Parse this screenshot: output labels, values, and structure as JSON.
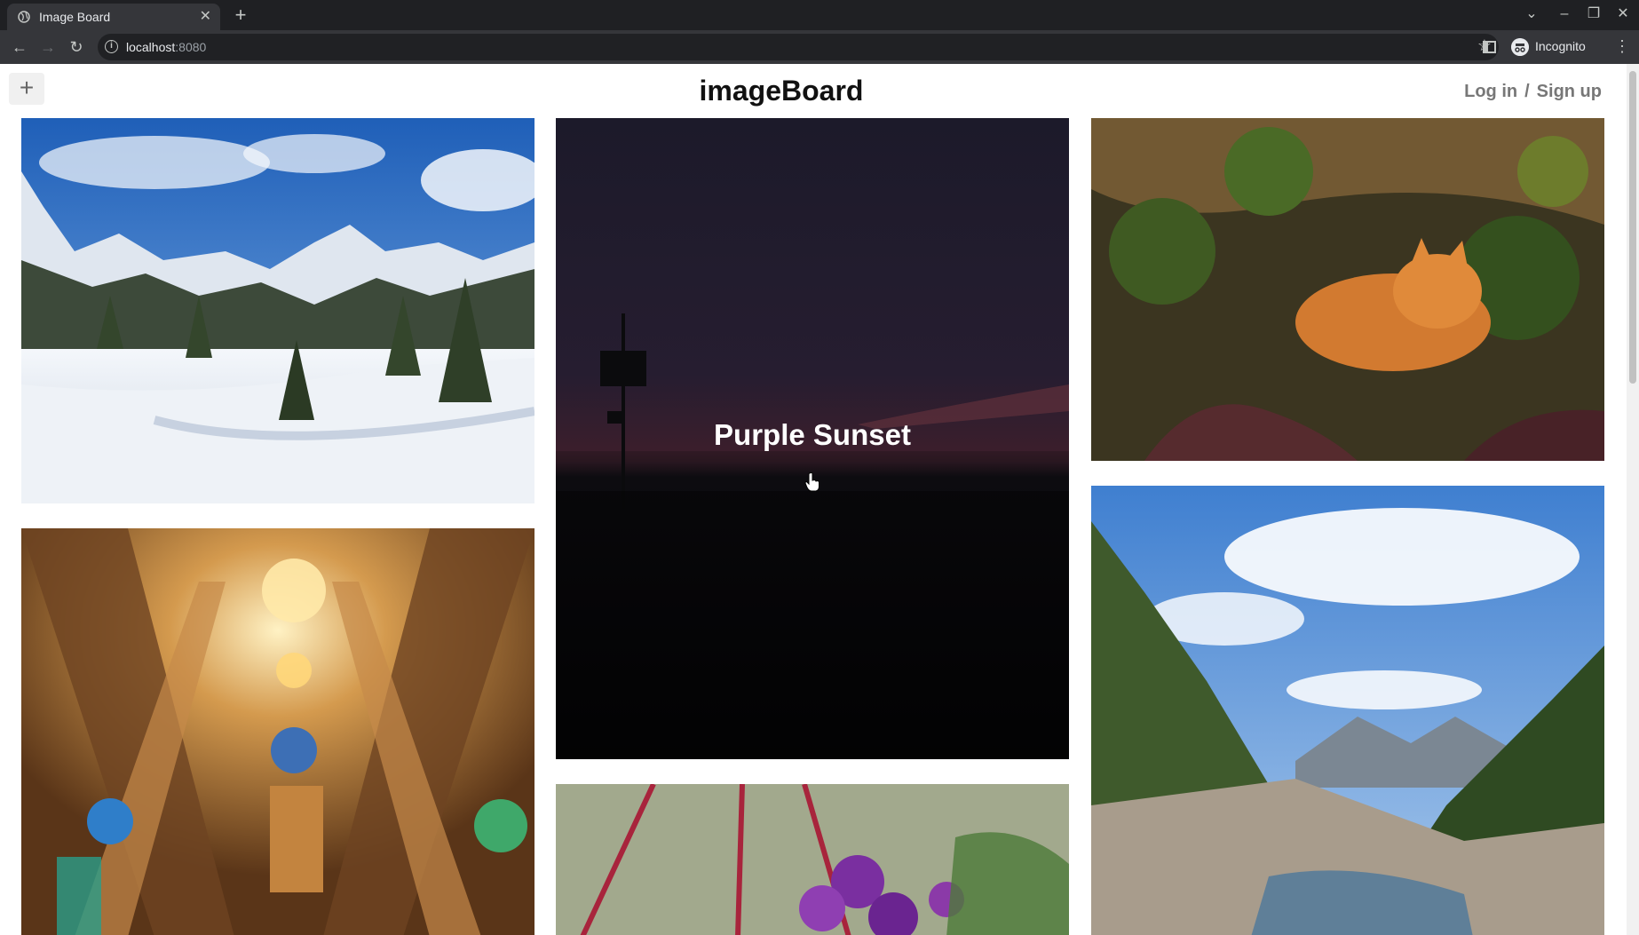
{
  "browser": {
    "tab_title": "Image Board",
    "url_host": "localhost",
    "url_port": ":8080",
    "profile_label": "Incognito"
  },
  "header": {
    "add_label": "+",
    "title": "imageBoard",
    "login_label": "Log in",
    "separator": "/",
    "signup_label": "Sign up"
  },
  "gallery": {
    "hovered_title": "Purple Sunset",
    "images": [
      {
        "subject": "snowy-mountain"
      },
      {
        "subject": "cathedral-ceiling"
      },
      {
        "subject": "purple-sunset"
      },
      {
        "subject": "purple-flowers"
      },
      {
        "subject": "orange-cat"
      },
      {
        "subject": "mountain-river"
      }
    ]
  }
}
